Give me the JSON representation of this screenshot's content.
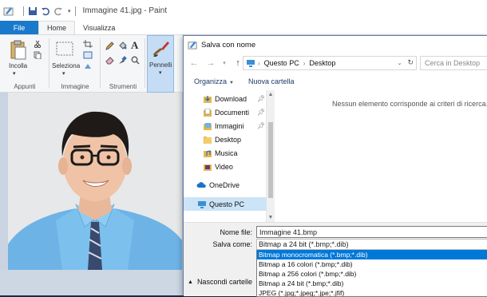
{
  "paint": {
    "title": "Immagine 41.jpg - Paint",
    "tabs": {
      "file": "File",
      "home": "Home",
      "view": "Visualizza"
    },
    "ribbon": {
      "groups": {
        "clipboard": "Appunti",
        "image": "Immagine",
        "tools": "Strumenti"
      },
      "paste_label": "Incolla",
      "select_label": "Seleziona",
      "brushes_label": "Pennelli"
    }
  },
  "dialog": {
    "title": "Salva con nome",
    "address": {
      "root": "Questo PC",
      "folder": "Desktop"
    },
    "search_placeholder": "Cerca in Desktop",
    "toolbar": {
      "organize": "Organizza",
      "new_folder": "Nuova cartella"
    },
    "nav_items": [
      {
        "label": "Download",
        "icon": "download-icon",
        "pinned": true
      },
      {
        "label": "Documenti",
        "icon": "documents-icon",
        "pinned": true
      },
      {
        "label": "Immagini",
        "icon": "pictures-icon",
        "pinned": true
      },
      {
        "label": "Desktop",
        "icon": "folder-icon",
        "pinned": false
      },
      {
        "label": "Musica",
        "icon": "music-icon",
        "pinned": false
      },
      {
        "label": "Video",
        "icon": "video-icon",
        "pinned": false
      },
      {
        "label": "OneDrive",
        "icon": "cloud-icon",
        "pinned": false
      },
      {
        "label": "Questo PC",
        "icon": "pc-icon",
        "pinned": false,
        "selected": true
      }
    ],
    "empty_message": "Nessun elemento corrisponde ai criteri di ricerca.",
    "file_name_label": "Nome file:",
    "file_name_value": "Immagine 41.bmp",
    "save_as_label": "Salva come:",
    "save_as_value": "Bitmap a 24 bit (*.bmp;*.dib)",
    "type_options": [
      {
        "label": "Bitmap monocromatica (*.bmp;*.dib)",
        "selected": true
      },
      {
        "label": "Bitmap a 16 colori (*.bmp;*.dib)",
        "selected": false
      },
      {
        "label": "Bitmap a 256 colori (*.bmp;*.dib)",
        "selected": false
      },
      {
        "label": "Bitmap a 24 bit (*.bmp;*.dib)",
        "selected": false
      },
      {
        "label": "JPEG (*.jpg;*.jpeg;*.jpe;*.jfif)",
        "selected": false
      }
    ],
    "hide_folders": "Nascondi cartelle"
  },
  "colors": {
    "accent": "#1979ca",
    "selection": "#0078d7",
    "nav_selected": "#cce4f7"
  }
}
